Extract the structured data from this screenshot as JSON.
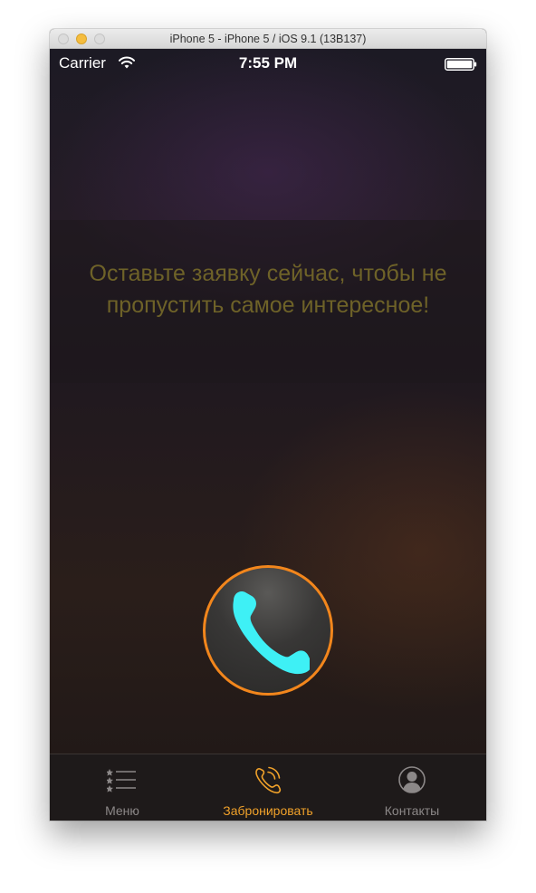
{
  "window": {
    "title": "iPhone 5 - iPhone 5 / iOS 9.1 (13B137)"
  },
  "status_bar": {
    "carrier": "Carrier",
    "time": "7:55 PM"
  },
  "promo": {
    "text": "Оставьте заявку сейчас, чтобы не пропустить самое интересное!"
  },
  "call_button": {
    "icon": "phone-icon"
  },
  "tabs": [
    {
      "label": "Меню",
      "icon": "menu-list-icon",
      "active": false
    },
    {
      "label": "Забронировать",
      "icon": "phone-ringing-icon",
      "active": true
    },
    {
      "label": "Контакты",
      "icon": "contact-person-icon",
      "active": false
    }
  ],
  "colors": {
    "accent": "#f0a12a",
    "call_ring": "#f2861c",
    "phone_glyph": "#3ef0f5",
    "promo_text": "#6e6228"
  }
}
